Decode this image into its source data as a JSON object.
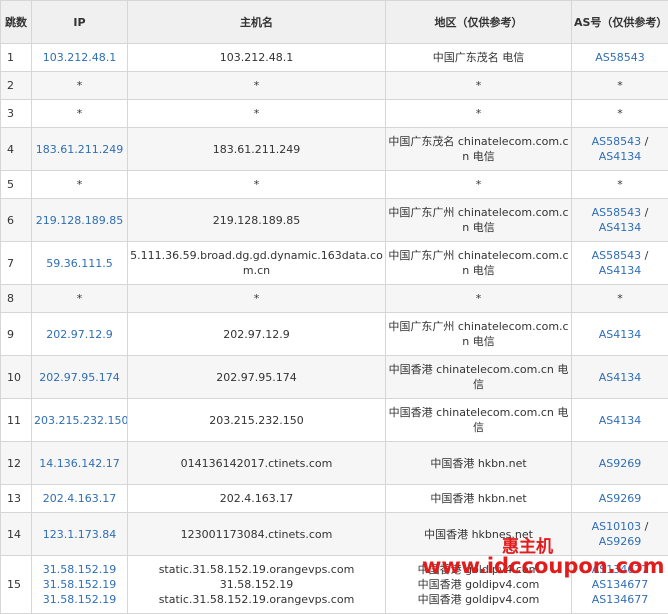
{
  "headers": {
    "hop": "跳数",
    "ip": "IP",
    "host": "主机名",
    "region": "地区（仅供参考）",
    "as": "AS号（仅供参考）"
  },
  "rows": [
    {
      "hop": "1",
      "ips": [
        "103.212.48.1"
      ],
      "hosts": [
        "103.212.48.1"
      ],
      "regions": [
        "中国广东茂名 电信"
      ],
      "as": [
        "AS58543"
      ]
    },
    {
      "hop": "2",
      "ips": [
        "*"
      ],
      "hosts": [
        "*"
      ],
      "regions": [
        "*"
      ],
      "as": [
        "*"
      ]
    },
    {
      "hop": "3",
      "ips": [
        "*"
      ],
      "hosts": [
        "*"
      ],
      "regions": [
        "*"
      ],
      "as": [
        "*"
      ]
    },
    {
      "hop": "4",
      "ips": [
        "183.61.211.249"
      ],
      "hosts": [
        "183.61.211.249"
      ],
      "regions": [
        "中国广东茂名 chinatelecom.com.cn 电信"
      ],
      "as": [
        "AS58543",
        "AS4134"
      ]
    },
    {
      "hop": "5",
      "ips": [
        "*"
      ],
      "hosts": [
        "*"
      ],
      "regions": [
        "*"
      ],
      "as": [
        "*"
      ]
    },
    {
      "hop": "6",
      "ips": [
        "219.128.189.85"
      ],
      "hosts": [
        "219.128.189.85"
      ],
      "regions": [
        "中国广东广州 chinatelecom.com.cn 电信"
      ],
      "as": [
        "AS58543",
        "AS4134"
      ]
    },
    {
      "hop": "7",
      "ips": [
        "59.36.111.5"
      ],
      "hosts": [
        "5.111.36.59.broad.dg.gd.dynamic.163data.com.cn"
      ],
      "regions": [
        "中国广东广州 chinatelecom.com.cn 电信"
      ],
      "as": [
        "AS58543",
        "AS4134"
      ]
    },
    {
      "hop": "8",
      "ips": [
        "*"
      ],
      "hosts": [
        "*"
      ],
      "regions": [
        "*"
      ],
      "as": [
        "*"
      ]
    },
    {
      "hop": "9",
      "ips": [
        "202.97.12.9"
      ],
      "hosts": [
        "202.97.12.9"
      ],
      "regions": [
        "中国广东广州 chinatelecom.com.cn 电信"
      ],
      "as": [
        "AS4134"
      ]
    },
    {
      "hop": "10",
      "ips": [
        "202.97.95.174"
      ],
      "hosts": [
        "202.97.95.174"
      ],
      "regions": [
        "中国香港 chinatelecom.com.cn 电信"
      ],
      "as": [
        "AS4134"
      ]
    },
    {
      "hop": "11",
      "ips": [
        "203.215.232.150"
      ],
      "hosts": [
        "203.215.232.150"
      ],
      "regions": [
        "中国香港 chinatelecom.com.cn 电信"
      ],
      "as": [
        "AS4134"
      ]
    },
    {
      "hop": "12",
      "ips": [
        "14.136.142.17"
      ],
      "hosts": [
        "014136142017.ctinets.com"
      ],
      "regions": [
        "中国香港 hkbn.net"
      ],
      "as": [
        "AS9269"
      ]
    },
    {
      "hop": "13",
      "ips": [
        "202.4.163.17"
      ],
      "hosts": [
        "202.4.163.17"
      ],
      "regions": [
        "中国香港 hkbn.net"
      ],
      "as": [
        "AS9269"
      ]
    },
    {
      "hop": "14",
      "ips": [
        "123.1.173.84"
      ],
      "hosts": [
        "123001173084.ctinets.com"
      ],
      "regions": [
        "中国香港 hkbnes.net"
      ],
      "as": [
        "AS10103",
        "AS9269"
      ]
    },
    {
      "hop": "15",
      "ips": [
        "31.58.152.19",
        "31.58.152.19",
        "31.58.152.19"
      ],
      "hosts": [
        "static.31.58.152.19.orangevps.com",
        "31.58.152.19",
        "static.31.58.152.19.orangevps.com"
      ],
      "regions": [
        "中国香港 goldipv4.com",
        "中国香港 goldipv4.com",
        "中国香港 goldipv4.com"
      ],
      "as": [
        "AS134677",
        "AS134677",
        "AS134677"
      ]
    }
  ],
  "watermark": {
    "title": "惠主机",
    "url": "www.idccoupon.com"
  },
  "colors": {
    "link": "#2f6eb5",
    "header_bg": "#f0f0f0",
    "stripe_bg": "#f6f6f6",
    "border": "#d6d6d6",
    "watermark": "#e21b1b"
  }
}
